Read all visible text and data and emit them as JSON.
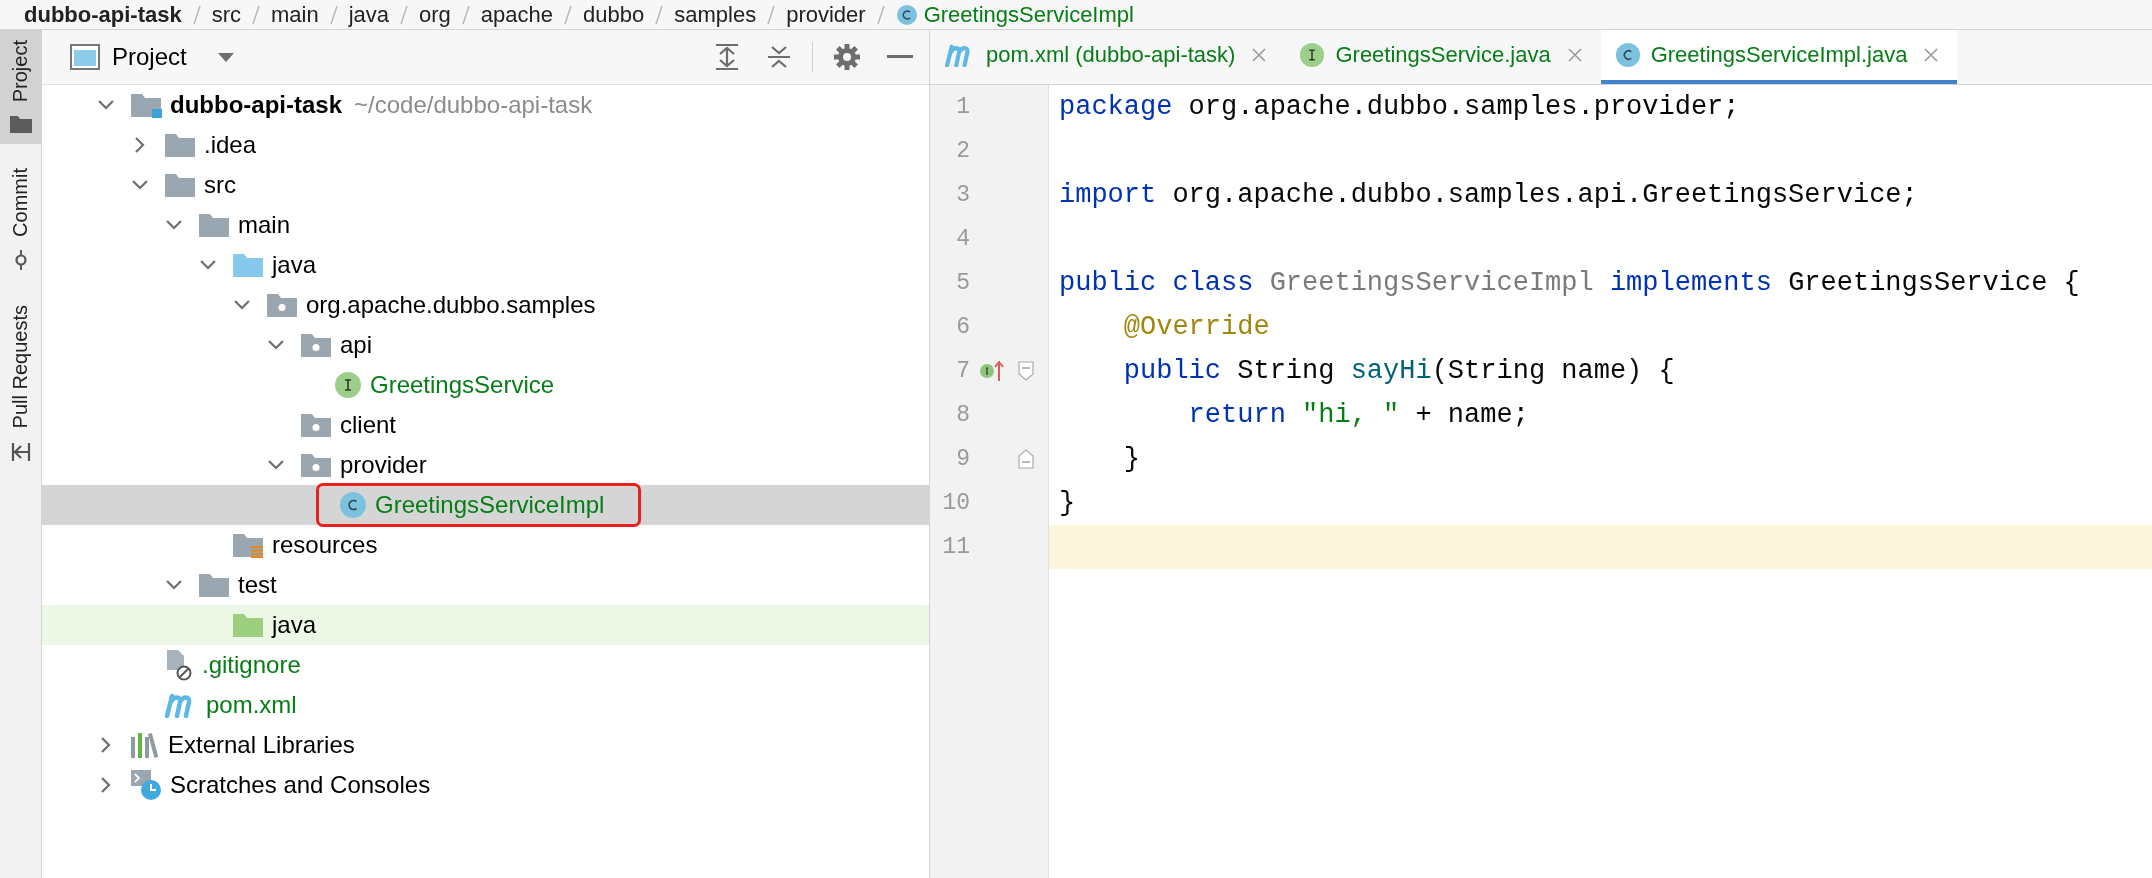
{
  "breadcrumbs": [
    {
      "label": "dubbo-api-task",
      "kind": "project"
    },
    {
      "label": "src",
      "kind": "folder"
    },
    {
      "label": "main",
      "kind": "folder"
    },
    {
      "label": "java",
      "kind": "folder"
    },
    {
      "label": "org",
      "kind": "folder"
    },
    {
      "label": "apache",
      "kind": "folder"
    },
    {
      "label": "dubbo",
      "kind": "folder"
    },
    {
      "label": "samples",
      "kind": "folder"
    },
    {
      "label": "provider",
      "kind": "folder"
    },
    {
      "label": "GreetingsServiceImpl",
      "kind": "class"
    }
  ],
  "tool_strip": [
    {
      "label": "Project",
      "kind": "folder",
      "selected": true
    },
    {
      "label": "Commit",
      "kind": "commit",
      "selected": false
    },
    {
      "label": "Pull Requests",
      "kind": "pull-request",
      "selected": false
    }
  ],
  "project_panel": {
    "title": "Project"
  },
  "tree": [
    {
      "label": "dubbo-api-task",
      "hint": "~/code/dubbo-api-task",
      "kind": "module",
      "expanded": true,
      "selected": false,
      "added": false,
      "annotated": false,
      "children": [
        {
          "label": ".idea",
          "kind": "folder",
          "expanded": false,
          "selected": false,
          "added": false,
          "annotated": false
        },
        {
          "label": "src",
          "kind": "folder",
          "expanded": true,
          "selected": false,
          "added": false,
          "annotated": false,
          "children": [
            {
              "label": "main",
              "kind": "folder",
              "expanded": true,
              "selected": false,
              "added": false,
              "annotated": false,
              "children": [
                {
                  "label": "java",
                  "kind": "source-folder",
                  "expanded": true,
                  "selected": false,
                  "added": false,
                  "annotated": false,
                  "children": [
                    {
                      "label": "org.apache.dubbo.samples",
                      "kind": "package",
                      "expanded": true,
                      "selected": false,
                      "added": false,
                      "annotated": false,
                      "children": [
                        {
                          "label": "api",
                          "kind": "package",
                          "expanded": true,
                          "selected": false,
                          "added": false,
                          "annotated": false,
                          "children": [
                            {
                              "label": "GreetingsService",
                              "kind": "interface",
                              "selected": false,
                              "added": true,
                              "annotated": false
                            }
                          ]
                        },
                        {
                          "label": "client",
                          "kind": "package",
                          "selected": false,
                          "added": false,
                          "annotated": false
                        },
                        {
                          "label": "provider",
                          "kind": "package",
                          "expanded": true,
                          "selected": false,
                          "added": false,
                          "annotated": false,
                          "children": [
                            {
                              "label": "GreetingsServiceImpl",
                              "kind": "class",
                              "selected": true,
                              "added": true,
                              "annotated": true
                            }
                          ]
                        }
                      ]
                    }
                  ]
                },
                {
                  "label": "resources",
                  "kind": "resource-folder",
                  "selected": false,
                  "added": false,
                  "annotated": false
                }
              ]
            },
            {
              "label": "test",
              "kind": "folder",
              "expanded": true,
              "selected": false,
              "added": false,
              "annotated": false,
              "children": [
                {
                  "label": "java",
                  "kind": "test-folder",
                  "selected": false,
                  "added": false,
                  "annotated": false
                }
              ]
            }
          ]
        },
        {
          "label": ".gitignore",
          "kind": "ignore-file",
          "selected": false,
          "added": true,
          "annotated": false
        },
        {
          "label": "pom.xml",
          "kind": "maven",
          "selected": false,
          "added": true,
          "annotated": false
        }
      ]
    },
    {
      "label": "External Libraries",
      "kind": "libraries",
      "expanded": false,
      "selected": false,
      "added": false,
      "annotated": false
    },
    {
      "label": "Scratches and Consoles",
      "kind": "scratches",
      "expanded": false,
      "selected": false,
      "added": false,
      "annotated": false
    }
  ],
  "tabs": [
    {
      "label": "pom.xml (dubbo-api-task)",
      "kind": "maven",
      "selected": false
    },
    {
      "label": "GreetingsService.java",
      "kind": "interface",
      "selected": false
    },
    {
      "label": "GreetingsServiceImpl.java",
      "kind": "class",
      "selected": true
    }
  ],
  "code": {
    "lines": [
      {
        "number": "1",
        "current": false,
        "tokens": [
          {
            "kind": "keyword",
            "text": "package"
          },
          {
            "kind": "plain",
            "text": " org.apache.dubbo.samples.provider;"
          }
        ]
      },
      {
        "number": "2",
        "current": false
      },
      {
        "number": "3",
        "current": false,
        "tokens": [
          {
            "kind": "keyword",
            "text": "import"
          },
          {
            "kind": "plain",
            "text": " org.apache.dubbo.samples.api.GreetingsService;"
          }
        ]
      },
      {
        "number": "4",
        "current": false
      },
      {
        "number": "5",
        "current": false,
        "tokens": [
          {
            "kind": "keyword",
            "text": "public class"
          },
          {
            "kind": "unused",
            "text": " GreetingsServiceImpl"
          },
          {
            "kind": "keyword",
            "text": " implements"
          },
          {
            "kind": "plain",
            "text": " GreetingsService {"
          }
        ]
      },
      {
        "number": "6",
        "current": false,
        "tokens": [
          {
            "kind": "annotation",
            "text": "    @Override"
          }
        ]
      },
      {
        "number": "7",
        "current": false,
        "implements_marker": true,
        "fold_start": true,
        "tokens": [
          {
            "kind": "keyword",
            "text": "    public"
          },
          {
            "kind": "plain",
            "text": " String"
          },
          {
            "kind": "method",
            "text": " sayHi"
          },
          {
            "kind": "plain",
            "text": "(String name) {"
          }
        ]
      },
      {
        "number": "8",
        "current": false,
        "tokens": [
          {
            "kind": "keyword",
            "text": "        return"
          },
          {
            "kind": "string",
            "text": " \"hi, \""
          },
          {
            "kind": "plain",
            "text": " + name;"
          }
        ]
      },
      {
        "number": "9",
        "current": false,
        "fold_end": true,
        "tokens": [
          {
            "kind": "plain",
            "text": "    }"
          }
        ]
      },
      {
        "number": "10",
        "current": false,
        "tokens": [
          {
            "kind": "plain",
            "text": "}"
          }
        ]
      },
      {
        "number": "11",
        "current": true
      }
    ]
  }
}
